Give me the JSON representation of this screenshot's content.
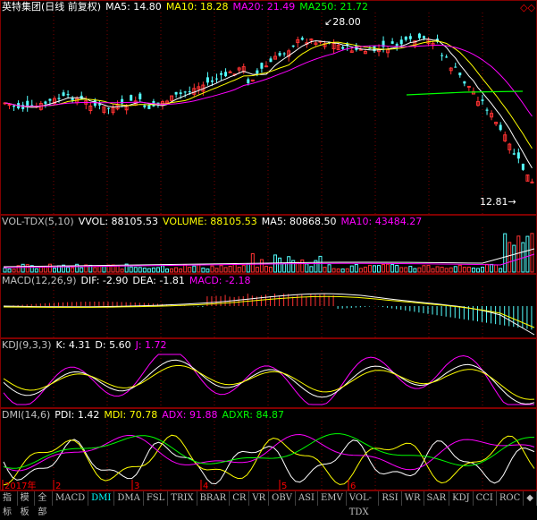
{
  "panels": {
    "main": {
      "items": [
        {
          "text": "英特集团(日线 前复权)",
          "color": "#ffffff"
        },
        {
          "text": "MA5: 14.80",
          "color": "#ffffff"
        },
        {
          "text": "MA10: 18.28",
          "color": "#ffff00"
        },
        {
          "text": "MA20: 21.49",
          "color": "#ff00ff"
        },
        {
          "text": "MA250: 21.72",
          "color": "#00ff00"
        }
      ],
      "high_label": "28.00",
      "low_label": "12.81",
      "arrows_glyph": "◇◇"
    },
    "vol": {
      "items": [
        {
          "text": "VOL-TDX(5,10)",
          "color": "#c0c0c0"
        },
        {
          "text": "VVOL: 88105.53",
          "color": "#ffffff"
        },
        {
          "text": "VOLUME: 88105.53",
          "color": "#ffff00"
        },
        {
          "text": "MA5: 80868.50",
          "color": "#ffffff"
        },
        {
          "text": "MA10: 43484.27",
          "color": "#ff00ff"
        }
      ]
    },
    "macd": {
      "items": [
        {
          "text": "MACD(12,26,9)",
          "color": "#c0c0c0"
        },
        {
          "text": "DIF: -2.90",
          "color": "#ffffff"
        },
        {
          "text": "DEA: -1.81",
          "color": "#ffffff"
        },
        {
          "text": "MACD: -2.18",
          "color": "#ff00ff"
        }
      ]
    },
    "kdj": {
      "items": [
        {
          "text": "KDJ(9,3,3)",
          "color": "#c0c0c0"
        },
        {
          "text": "K: 4.31",
          "color": "#ffffff"
        },
        {
          "text": "D: 5.60",
          "color": "#ffffff"
        },
        {
          "text": "J: 1.72",
          "color": "#ff00ff"
        }
      ]
    },
    "dmi": {
      "items": [
        {
          "text": "DMI(14,6)",
          "color": "#c0c0c0"
        },
        {
          "text": "PDI: 1.42",
          "color": "#ffffff"
        },
        {
          "text": "MDI: 70.78",
          "color": "#ffff00"
        },
        {
          "text": "ADX: 91.88",
          "color": "#ff00ff"
        },
        {
          "text": "ADXR: 84.87",
          "color": "#00ff00"
        }
      ]
    }
  },
  "axis": {
    "months": [
      "2017年",
      "2",
      "3",
      "4",
      "5",
      "6"
    ]
  },
  "tabs": [
    {
      "label": "指标",
      "active": false,
      "mono": false,
      "sel": false
    },
    {
      "label": "模板",
      "active": false,
      "mono": false,
      "sel": false
    },
    {
      "label": "全部",
      "active": false,
      "mono": false,
      "sel": false
    },
    {
      "label": "MACD",
      "active": false,
      "mono": true,
      "sel": false
    },
    {
      "label": "DMI",
      "active": true,
      "mono": true,
      "sel": false
    },
    {
      "label": "DMA",
      "active": false,
      "mono": true,
      "sel": false
    },
    {
      "label": "FSL",
      "active": false,
      "mono": true,
      "sel": false
    },
    {
      "label": "TRIX",
      "active": false,
      "mono": true,
      "sel": false
    },
    {
      "label": "BRAR",
      "active": false,
      "mono": true,
      "sel": false
    },
    {
      "label": "CR",
      "active": false,
      "mono": true,
      "sel": false
    },
    {
      "label": "VR",
      "active": false,
      "mono": true,
      "sel": false
    },
    {
      "label": "OBV",
      "active": false,
      "mono": true,
      "sel": false
    },
    {
      "label": "ASI",
      "active": false,
      "mono": true,
      "sel": false
    },
    {
      "label": "EMV",
      "active": false,
      "mono": true,
      "sel": false
    },
    {
      "label": "VOL-TDX",
      "active": false,
      "mono": true,
      "sel": false
    },
    {
      "label": "RSI",
      "active": false,
      "mono": true,
      "sel": false
    },
    {
      "label": "WR",
      "active": false,
      "mono": true,
      "sel": false
    },
    {
      "label": "SAR",
      "active": false,
      "mono": true,
      "sel": false
    },
    {
      "label": "KDJ",
      "active": false,
      "mono": true,
      "sel": false
    },
    {
      "label": "CCI",
      "active": false,
      "mono": true,
      "sel": false
    },
    {
      "label": "ROC",
      "active": false,
      "mono": true,
      "sel": false
    },
    {
      "label": "◆",
      "active": false,
      "mono": false,
      "sel": false
    }
  ],
  "colors": {
    "up": "#ff3232",
    "down": "#54ffff",
    "grid": "#800000",
    "ma5": "#ffffff",
    "ma10": "#ffff00",
    "ma20": "#ff00ff",
    "ma250": "#00ff00"
  }
}
